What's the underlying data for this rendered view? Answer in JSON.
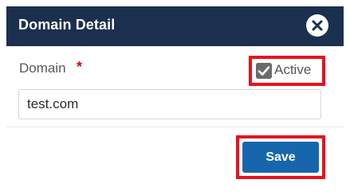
{
  "dialog": {
    "title": "Domain Detail",
    "close_icon": "close-icon"
  },
  "form": {
    "domain_label": "Domain",
    "required_marker": "*",
    "domain_value": "test.com",
    "active_label": "Active",
    "active_checked": true
  },
  "footer": {
    "save_label": "Save"
  },
  "colors": {
    "header_bg": "#1b2f4f",
    "highlight": "#e8121c",
    "primary_button": "#1766ad",
    "required": "#d9000d"
  }
}
